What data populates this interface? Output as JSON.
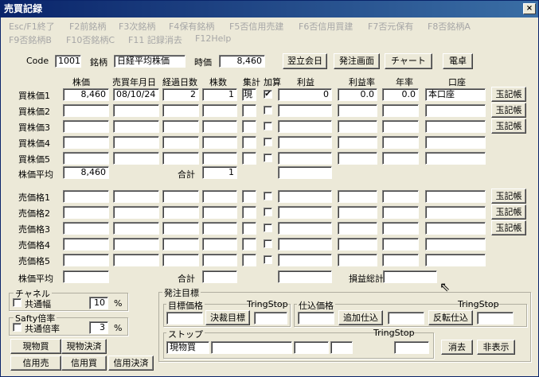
{
  "window": {
    "title": "売買記録",
    "close": "×"
  },
  "fkeys": {
    "esc": "Esc/F1終了",
    "f2": "F2前銘柄",
    "f3": "F3次銘柄",
    "f4": "F4保有銘柄",
    "f5": "F5否信用売建",
    "f6": "F6否信用買建",
    "f7": "F7否元保有",
    "f8": "F8否銘柄A",
    "f9": "F9否銘柄B",
    "f10": "F10否銘柄C",
    "f11": "F11 記録消去",
    "f12": "F12Help"
  },
  "header": {
    "code_label": "Code",
    "code": "1001",
    "name_label": "銘柄",
    "name": "日経平均株価",
    "price_label": "時価",
    "price": "8,460",
    "btn_next_day": "翌立会日",
    "btn_order": "発注画面",
    "btn_chart": "チャート",
    "btn_calc": "電卓"
  },
  "cols": {
    "price": "株価",
    "date": "売買年月日",
    "days": "経過日数",
    "qty": "株数",
    "sum": "集計",
    "add": "加算",
    "profit": "利益",
    "rate": "利益率",
    "annual": "年率",
    "account": "口座"
  },
  "buy_rows": [
    {
      "label": "買株価1",
      "price": "8,460",
      "date": "08/10/24",
      "days": "2",
      "qty": "1",
      "type": "現",
      "checked": "✔",
      "profit": "0",
      "rate": "0.0",
      "annual": "0.0",
      "account": "本口座",
      "button": "玉記帳"
    },
    {
      "label": "買株価2",
      "price": "",
      "date": "",
      "days": "",
      "qty": "",
      "type": "",
      "checked": "",
      "profit": "",
      "rate": "",
      "annual": "",
      "account": "",
      "button": "玉記帳"
    },
    {
      "label": "買株価3",
      "price": "",
      "date": "",
      "days": "",
      "qty": "",
      "type": "",
      "checked": "",
      "profit": "",
      "rate": "",
      "annual": "",
      "account": "",
      "button": "玉記帳"
    },
    {
      "label": "買株価4",
      "price": "",
      "date": "",
      "days": "",
      "qty": "",
      "type": "",
      "checked": "",
      "profit": "",
      "rate": "",
      "annual": "",
      "account": "",
      "button": ""
    },
    {
      "label": "買株価5",
      "price": "",
      "date": "",
      "days": "",
      "qty": "",
      "type": "",
      "checked": "",
      "profit": "",
      "rate": "",
      "annual": "",
      "account": "",
      "button": ""
    }
  ],
  "buy_avg": {
    "label": "株価平均",
    "price": "8,460",
    "total_label": "合計",
    "total": "1",
    "profit": ""
  },
  "sell_rows": [
    {
      "label": "売価格1",
      "button": "玉記帳"
    },
    {
      "label": "売価格2",
      "button": "玉記帳"
    },
    {
      "label": "売価格3",
      "button": "玉記帳"
    },
    {
      "label": "売価格4",
      "button": ""
    },
    {
      "label": "売価格5",
      "button": ""
    }
  ],
  "sell_avg": {
    "label": "株価平均",
    "price": "",
    "total_label": "合計",
    "total": "",
    "pl_label": "損益総計",
    "pl": ""
  },
  "channel": {
    "title": "チャネル",
    "check_label": "共通幅",
    "value": "10",
    "unit": "%"
  },
  "safety": {
    "title": "Safty倍率",
    "check_label": "共通倍率",
    "value": "3",
    "unit": "%"
  },
  "bottom_buttons": {
    "spot_buy": "現物買",
    "spot_settle": "現物決済",
    "credit_sell": "信用売",
    "credit_buy": "信用買",
    "credit_settle": "信用決済"
  },
  "order": {
    "title": "発注目標",
    "target_price": "目標価格",
    "tring1": "TringStop",
    "decide_btn": "決裁目標",
    "buy_price": "仕込価格",
    "tring2": "TringStop",
    "add_btn": "追加仕込",
    "reverse_btn": "反転仕込",
    "stop_title": "ストップ",
    "tring3": "TringStop",
    "stop_type": "現物買",
    "clear_btn": "消去",
    "hide_btn": "非表示"
  }
}
